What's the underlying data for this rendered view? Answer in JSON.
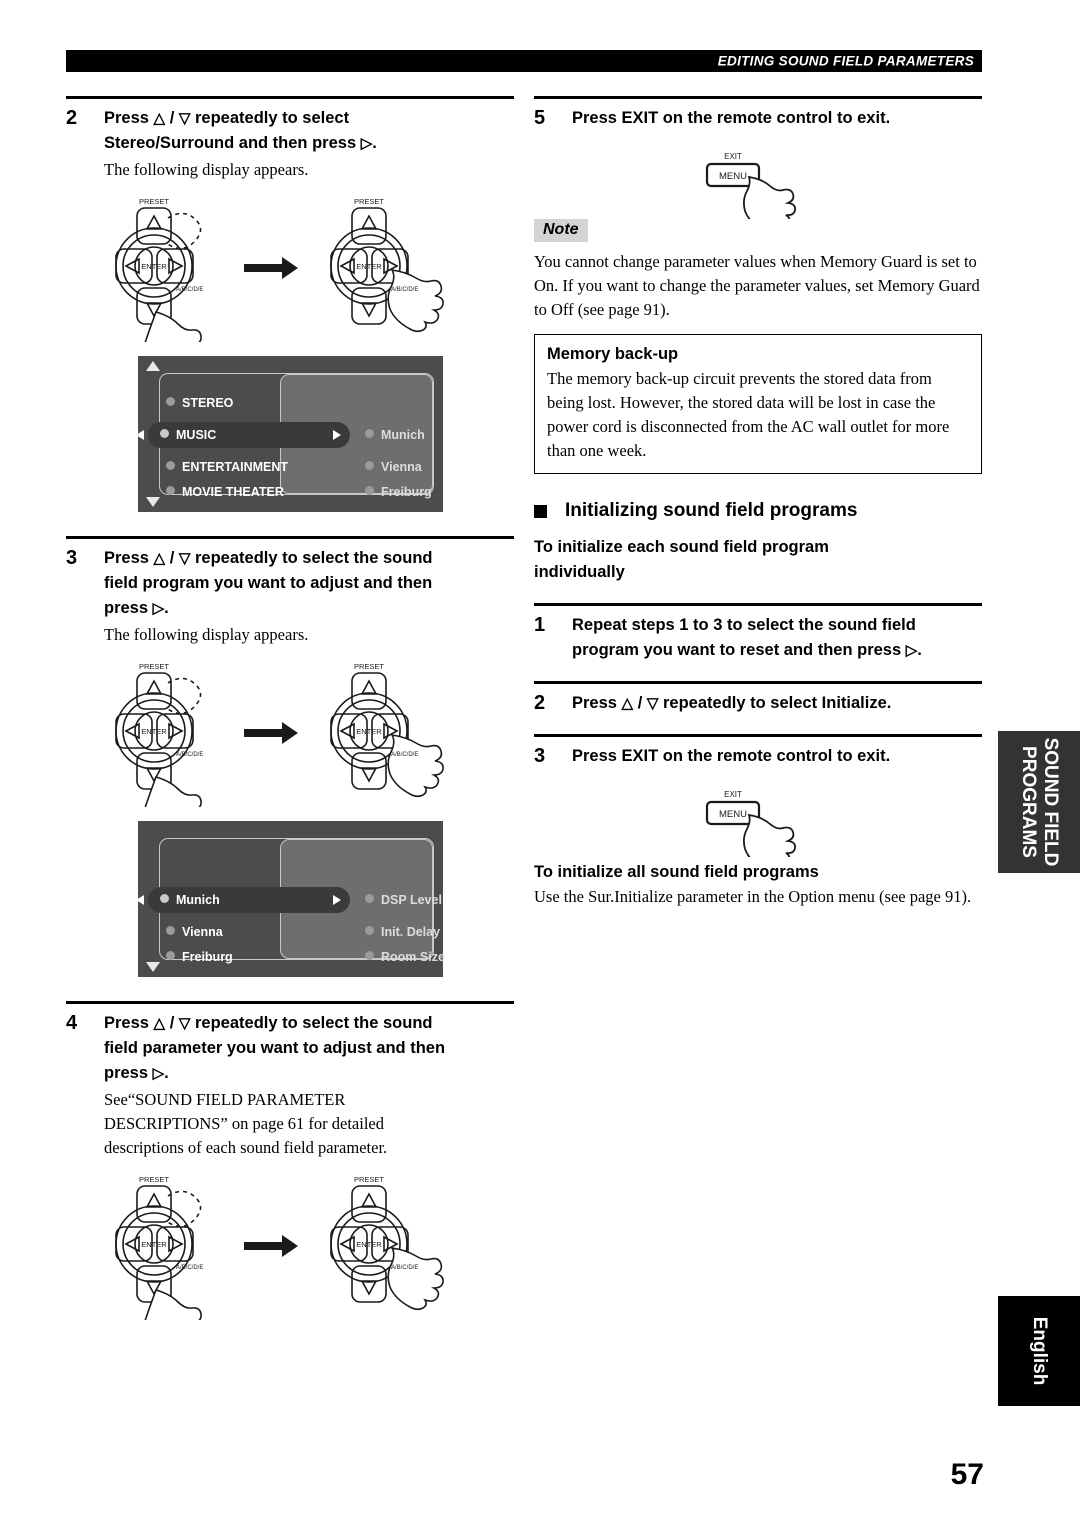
{
  "header": {
    "title": "EDITING SOUND FIELD PARAMETERS"
  },
  "page_number": "57",
  "glyphs": {
    "up": "△",
    "down": "▽",
    "right": "▷",
    "slash": "/"
  },
  "left_column": {
    "step2": {
      "num": "2",
      "head_line1_a": "Press ",
      "head_line1_b": " repeatedly to select",
      "head_line2_a": "Stereo/Surround and then press ",
      "head_line2_b": ".",
      "body": "The following display appears."
    },
    "step3": {
      "num": "3",
      "head_line1_a": "Press ",
      "head_line1_b": " repeatedly to select the sound",
      "head_line2": "field program you want to adjust and then",
      "head_line3_a": "press ",
      "head_line3_b": ".",
      "body": "The following display appears."
    },
    "step4": {
      "num": "4",
      "head_line1_a": "Press ",
      "head_line1_b": " repeatedly to select the sound",
      "head_line2": "field parameter you want to adjust and then",
      "head_line3_a": "press ",
      "head_line3_b": ".",
      "body": "See“SOUND FIELD PARAMETER DESCRIPTIONS” on page 61 for detailed descriptions of each sound field parameter."
    },
    "osd1": {
      "left_items": [
        "STEREO",
        "MUSIC",
        "ENTERTAINMENT",
        "MOVIE THEATER"
      ],
      "selected_left": "MUSIC",
      "right_items": [
        "Munich",
        "Vienna",
        "Freiburg"
      ],
      "has_up_arrow": true,
      "has_down_arrow": true
    },
    "osd2": {
      "left_items": [
        "",
        "Munich",
        "Vienna",
        "Freiburg"
      ],
      "selected_left": "Munich",
      "right_items": [
        "DSP Level",
        "Init. Delay",
        "Room Size"
      ],
      "has_up_arrow": false,
      "has_down_arrow": true
    }
  },
  "right_column": {
    "step5": {
      "num": "5",
      "head": "Press EXIT on the remote control to exit."
    },
    "note": {
      "tag": "Note",
      "text": "You cannot change parameter values when Memory Guard is set to On. If you want to change the parameter values, set Memory Guard to Off (see page 91)."
    },
    "memory_backup": {
      "title": "Memory back-up",
      "text": "The memory back-up circuit prevents the stored data from being lost. However, the stored data will be lost in case the power cord is disconnected from the AC wall outlet for more than one week."
    },
    "section": {
      "heading": "Initializing sound field programs",
      "sub_head_line1": "To initialize each sound field program",
      "sub_head_line2": "individually"
    },
    "init_step1": {
      "num": "1",
      "head_line1": "Repeat steps 1 to 3 to select the sound field",
      "head_line2_a": "program you want to reset and then press ",
      "head_line2_b": "."
    },
    "init_step2": {
      "num": "2",
      "head_a": "Press ",
      "head_b": " repeatedly to select Initialize."
    },
    "init_step3": {
      "num": "3",
      "head": "Press EXIT on the remote control to exit."
    },
    "init_all": {
      "title": "To initialize all sound field programs",
      "text": "Use the Sur.Initialize parameter in the Option menu (see page 91)."
    }
  },
  "remote_figure": {
    "preset_label": "PRESET",
    "enter_label": "ENTER",
    "abcde_label": "A/B/C/D/E"
  },
  "exit_figure": {
    "exit_label": "EXIT",
    "menu_label": "MENU"
  },
  "side_tabs": {
    "sound_field": "SOUND FIELD\nPROGRAMS",
    "sound_field_line1": "SOUND FIELD",
    "sound_field_line2": "PROGRAMS",
    "english": "English"
  },
  "colors": {
    "header_bar": "#000000",
    "osd_background": "#4c4c4c",
    "osd_panel": "#6e6e6e",
    "osd_selected": "#3a3a3a",
    "note_tag_bg": "#d4d4d4",
    "side_tab_bg": "#333333"
  }
}
